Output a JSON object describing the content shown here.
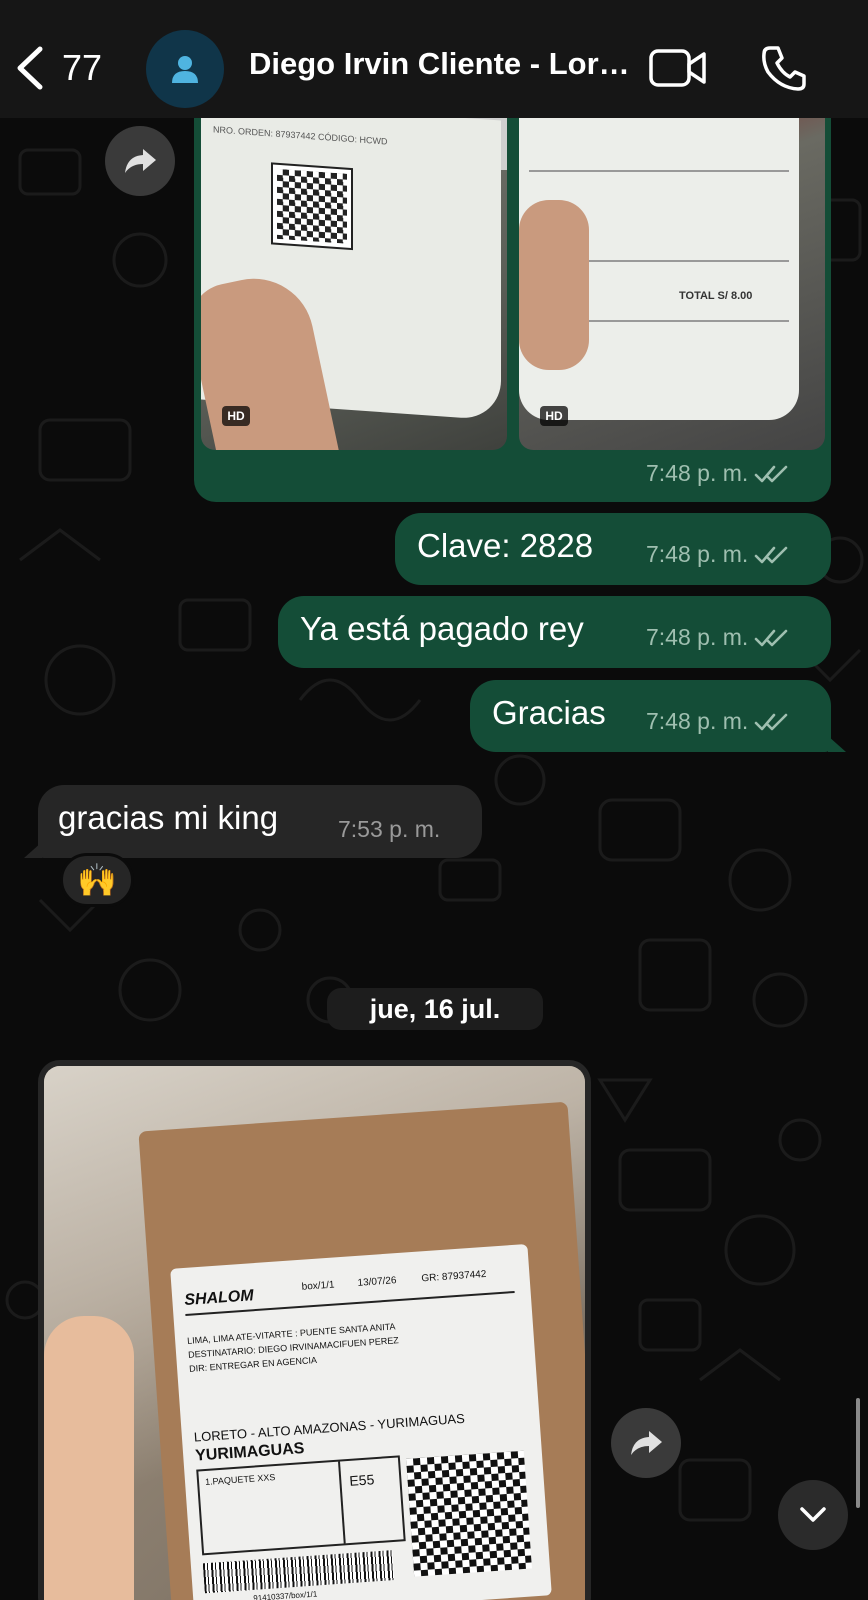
{
  "header": {
    "back_count": "77",
    "contact_name": "Diego Irvin Cliente - Loreto"
  },
  "messages": [
    {
      "type": "image-pair",
      "time": "7:48 p. m.",
      "hd_badges": [
        "HD",
        "HD"
      ],
      "receipts": [
        "NRO. ORDEN: 87937442 CÓDIGO: HCWD",
        "TOTAL S/ 8.00"
      ]
    },
    {
      "type": "text-out",
      "text": "Clave: 2828",
      "time": "7:48 p. m."
    },
    {
      "type": "text-out",
      "text": "Ya está pagado rey",
      "time": "7:48 p. m."
    },
    {
      "type": "text-out",
      "text": "Gracias",
      "time": "7:48 p. m."
    },
    {
      "type": "text-in",
      "text": "gracias mi king",
      "time": "7:53 p. m.",
      "reaction": "🙌"
    }
  ],
  "date_separator": "jue, 16 jul.",
  "package_photo": {
    "brand": "SHALOM",
    "box": "box/1/1",
    "date": "13/07/26",
    "gr": "GR: 87937442",
    "origin": "LIMA, LIMA ATE-VITARTE : PUENTE SANTA ANITA",
    "recipient": "DESTINATARIO: DIEGO IRVINAMACIFUEN PEREZ",
    "dir": "DIR: ENTREGAR EN AGENCIA",
    "route": "LORETO - ALTO AMAZONAS - YURIMAGUAS",
    "city": "YURIMAGUAS",
    "package": "1.PAQUETE XXS",
    "code": "E55",
    "barcode_text": "91410337/box/1/1"
  },
  "colors": {
    "outgoing_bubble": "#144d37",
    "incoming_bubble": "#262626",
    "background": "#0b0b0b"
  },
  "icons": [
    "chevron-left-icon",
    "user-icon",
    "video-camera-icon",
    "phone-icon",
    "forward-icon",
    "double-check-icon",
    "chevron-down-icon"
  ]
}
